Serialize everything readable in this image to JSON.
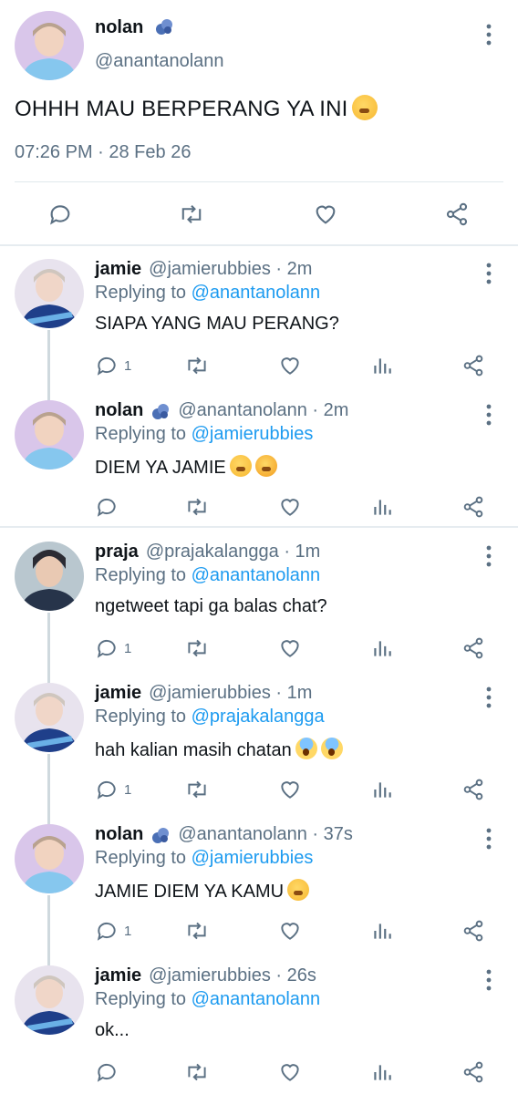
{
  "main_tweet": {
    "name": "nolan",
    "handle": "@anantanolann",
    "text": "OHHH MAU BERPERANG YA INI",
    "timestamp": "07:26 PM · 28 Feb 26",
    "icons": [
      "comment-icon",
      "retweet-icon",
      "like-icon",
      "share-icon"
    ]
  },
  "replies": [
    {
      "name": "jamie",
      "verified": false,
      "meta": "@jamierubbies · 2m",
      "replying_prefix": "Replying to",
      "replying_to": "@anantanolann",
      "text": "SIAPA YANG MAU PERANG?",
      "reply_count": "1",
      "emoji": []
    },
    {
      "name": "nolan",
      "verified": true,
      "meta": "@anantanolann · 2m",
      "replying_prefix": "Replying to",
      "replying_to": "@jamierubbies",
      "text": "DIEM YA JAMIE",
      "reply_count": "",
      "emoji": [
        "steam",
        "angry"
      ]
    },
    {
      "name": "praja",
      "verified": false,
      "meta": "@prajakalangga · 1m",
      "replying_prefix": "Replying to",
      "replying_to": "@anantanolann",
      "text": "ngetweet tapi ga balas chat?",
      "reply_count": "1",
      "emoji": []
    },
    {
      "name": "jamie",
      "verified": false,
      "meta": "@jamierubbies · 1m",
      "replying_prefix": "Replying to",
      "replying_to": "@prajakalangga",
      "text": "hah kalian masih chatan",
      "reply_count": "1",
      "emoji": [
        "scream",
        "scream"
      ]
    },
    {
      "name": "nolan",
      "verified": true,
      "meta": "@anantanolann · 37s",
      "replying_prefix": "Replying to",
      "replying_to": "@jamierubbies",
      "text": "JAMIE DIEM YA KAMU",
      "reply_count": "1",
      "emoji": [
        "steam"
      ]
    },
    {
      "name": "jamie",
      "verified": false,
      "meta": "@jamierubbies · 26s",
      "replying_prefix": "Replying to",
      "replying_to": "@anantanolann",
      "text": "ok...",
      "reply_count": "",
      "emoji": []
    }
  ],
  "colors": {
    "text": "#0f1419",
    "secondary": "#5b7083",
    "link": "#1d9bf0",
    "divider": "#e6ecf0"
  }
}
